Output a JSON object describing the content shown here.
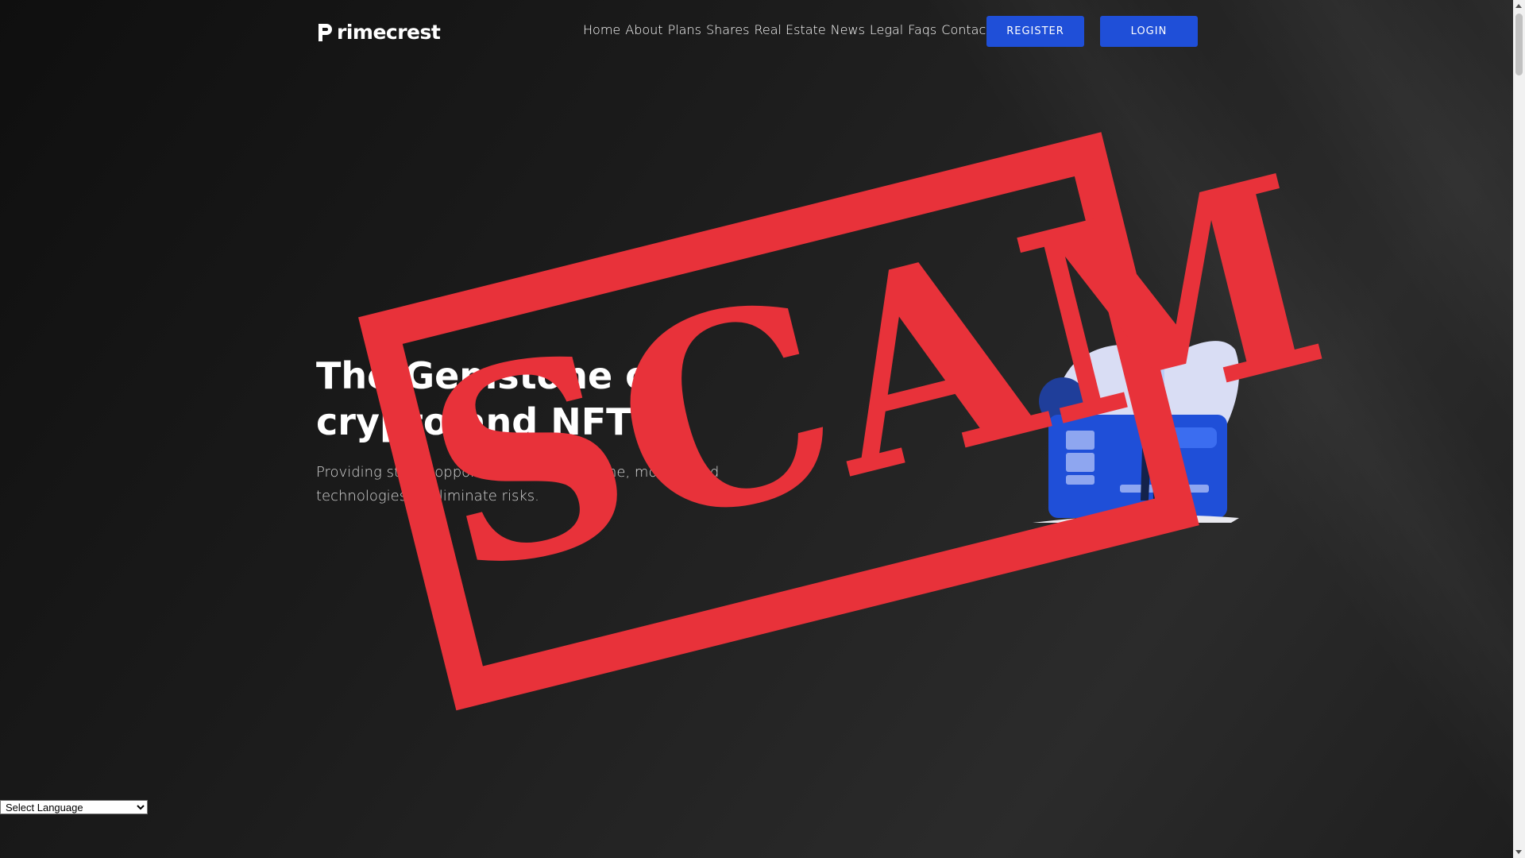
{
  "brand": {
    "logo_text": "rimecrest",
    "logo_icon": "p-logo-icon"
  },
  "nav": {
    "items": [
      "Home",
      "About",
      "Plans",
      "Shares",
      "Real Estate",
      "News",
      "Legal",
      "Faqs",
      "Contact"
    ]
  },
  "buttons": {
    "register": "REGISTER",
    "login": "LOGIN"
  },
  "hero": {
    "title": "The Gemstone of crypto and NFT",
    "subtitle": "Providing stable opportunities for everyone, modernised technologies to eliminate risks."
  },
  "stamp": {
    "text": "SCAM",
    "color": "#e8323a"
  },
  "language": {
    "selected": "Select Language"
  },
  "colors": {
    "accent": "#1f4fd8",
    "background": "#1b1b1b"
  }
}
